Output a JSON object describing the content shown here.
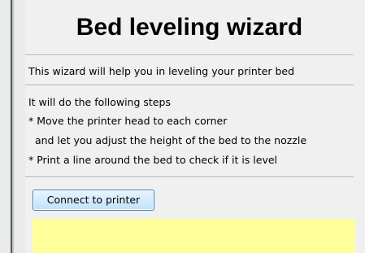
{
  "wizard": {
    "title": "Bed leveling wizard",
    "intro": "This wizard will help you in leveling your printer bed",
    "steps_header": "It will do the following steps",
    "step1_line1": "* Move the printer head to each corner",
    "step1_line2": "  and let you adjust the height of the bed to the nozzle",
    "step2": "* Print a line around the bed to check if it is level",
    "connect_button_label": "Connect to printer"
  },
  "colors": {
    "status_area": "#fefe9b",
    "button_border": "#3c7fb1"
  }
}
